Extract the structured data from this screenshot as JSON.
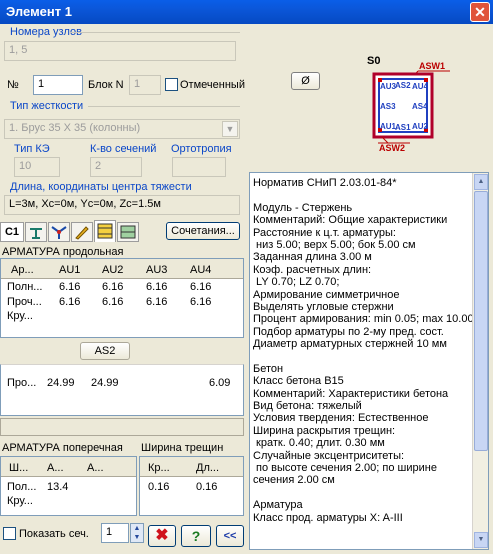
{
  "window": {
    "title": "Элемент 1",
    "close": "✕"
  },
  "nodes": {
    "label": "Номера узлов",
    "value": "1, 5"
  },
  "numrow": {
    "n_label": "№",
    "n_value": "1",
    "block_label": "Блок N",
    "block_value": "1",
    "marked_label": "Отмеченный"
  },
  "stiff": {
    "label": "Тип жесткости",
    "value": "1. Брус 35 X 35 (колонны)"
  },
  "ke": {
    "type_label": "Тип КЭ",
    "type_value": "10",
    "sections_label": "К-во сечений",
    "sections_value": "2",
    "ortho_label": "Ортотропия"
  },
  "length": {
    "label": "Длина, координаты центра тяжести",
    "value": "L=3м, Xc=0м, Yc=0м, Zc=1.5м"
  },
  "tabs": {
    "c1": "С1",
    "combo_button": "Сочетания..."
  },
  "long_rebar": {
    "label": "АРМАТУРА продольная",
    "headers": [
      "Ар...",
      "AU1",
      "AU2",
      "AU3",
      "AU4"
    ],
    "rows": [
      [
        "Полн...",
        "6.16",
        "6.16",
        "6.16",
        "6.16"
      ],
      [
        "Проч...",
        "6.16",
        "6.16",
        "6.16",
        "6.16"
      ],
      [
        "Кру...",
        "",
        "",
        "",
        ""
      ]
    ],
    "as2_button": "AS2",
    "as2_row": [
      "Про...",
      "24.99",
      "24.99",
      "",
      "6.09"
    ]
  },
  "trans_rebar": {
    "label": "АРМАТУРА поперечная",
    "headers": [
      "Ш...",
      "А...",
      "А..."
    ],
    "rows": [
      [
        "Пол...",
        "13.4",
        ""
      ],
      [
        "Кру...",
        "",
        ""
      ]
    ]
  },
  "crack": {
    "label": "Ширина трещин",
    "headers": [
      "Кр...",
      "Дл..."
    ],
    "rows": [
      [
        "0.16",
        "0.16"
      ]
    ]
  },
  "bottom": {
    "show_label": "Показать сеч.",
    "spin_value": "1",
    "delete_icon": "✖",
    "help_icon": "?",
    "collapse_icon": "<<"
  },
  "section_diagram": {
    "title": "S0",
    "asw1": "ASW1",
    "asw2": "ASW2",
    "au1": "AU1",
    "au2": "AU2",
    "au3": "AU3",
    "au4": "AU4",
    "as1": "AS1",
    "as2": "AS2",
    "as3": "AS3",
    "as4": "AS4",
    "diameter_button": "Ø"
  },
  "report": {
    "lines": [
      "Норматив СНиП 2.03.01-84*",
      "",
      "Модуль - Стержень",
      "Комментарий: Общие характеристики",
      "Расстояние к ц.т. арматуры:",
      " низ 5.00; верх 5.00; бок 5.00 см",
      "Заданная длина 3.00 м",
      "Коэф. расчетных длин:",
      " LY 0.70; LZ 0.70;",
      "Армирование симметричное",
      "Выделять угловые стержни",
      "Процент армирования: min 0.05; max 10.00",
      "Подбор арматуры по 2-му пред. сост.",
      "Диаметр арматурных стержней 10 мм",
      "",
      "Бетон",
      "Класс бетона В15",
      "Комментарий: Характеристики бетона",
      "Вид бетона: тяжелый",
      "Условия твердения: Естественное",
      "Ширина раскрытия трещин:",
      " кратк. 0.40; длит. 0.30 мм",
      "Случайные эксцентриситеты:",
      " по высоте сечения 2.00; по ширине",
      "сечения 2.00 см",
      "",
      "Арматура",
      "Класс прод. арматуры X: A-III"
    ]
  }
}
